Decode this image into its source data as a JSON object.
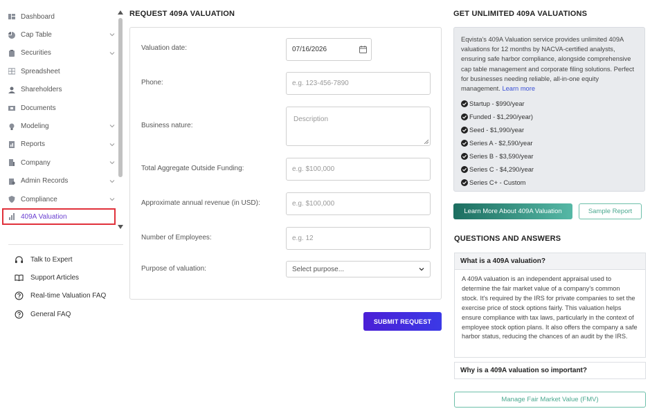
{
  "sidebar": {
    "items": [
      {
        "label": "Dashboard",
        "icon": "dashboard-icon",
        "chevron": false
      },
      {
        "label": "Cap Table",
        "icon": "pie-chart-icon",
        "chevron": true
      },
      {
        "label": "Securities",
        "icon": "clipboard-icon",
        "chevron": true
      },
      {
        "label": "Spreadsheet",
        "icon": "spreadsheet-icon",
        "chevron": false
      },
      {
        "label": "Shareholders",
        "icon": "user-icon",
        "chevron": false
      },
      {
        "label": "Documents",
        "icon": "folder-icon",
        "chevron": false
      },
      {
        "label": "Modeling",
        "icon": "lightbulb-icon",
        "chevron": true
      },
      {
        "label": "Reports",
        "icon": "report-icon",
        "chevron": true
      },
      {
        "label": "Company",
        "icon": "building-icon",
        "chevron": true
      },
      {
        "label": "Admin Records",
        "icon": "admin-icon",
        "chevron": true
      },
      {
        "label": "Compliance",
        "icon": "shield-icon",
        "chevron": true
      },
      {
        "label": "409A Valuation",
        "icon": "chart-icon",
        "chevron": false,
        "active": true
      }
    ],
    "help": [
      {
        "label": "Talk to Expert",
        "icon": "headset-icon"
      },
      {
        "label": "Support Articles",
        "icon": "book-icon"
      },
      {
        "label": "Real-time Valuation FAQ",
        "icon": "question-circle-icon"
      },
      {
        "label": "General FAQ",
        "icon": "question-circle-icon"
      }
    ]
  },
  "form": {
    "title": "REQUEST 409A VALUATION",
    "fields": {
      "valuation_date": {
        "label": "Valuation date:",
        "value": "07/16/2026"
      },
      "phone": {
        "label": "Phone:",
        "placeholder": "e.g. 123-456-7890"
      },
      "business_nature": {
        "label": "Business nature:",
        "placeholder": "Description"
      },
      "funding": {
        "label": "Total Aggregate Outside Funding:",
        "placeholder": "e.g. $100,000"
      },
      "revenue": {
        "label": "Approximate annual revenue (in USD):",
        "placeholder": "e.g. $100,000"
      },
      "employees": {
        "label": "Number of Employees:",
        "placeholder": "e.g. 12"
      },
      "purpose": {
        "label": "Purpose of valuation:",
        "selected": "Select purpose..."
      }
    },
    "submit_label": "SUBMIT REQUEST"
  },
  "promo": {
    "title": "GET UNLIMITED 409A VALUATIONS",
    "description": "Eqvista's 409A Valuation service provides unlimited 409A valuations for 12 months by NACVA-certified analysts, ensuring safe harbor compliance, alongside comprehensive cap table management and corporate filing solutions. Perfect for businesses needing reliable, all-in-one equity management.",
    "learn_more": "Learn more",
    "plans": [
      "Startup - $990/year",
      "Funded - $1,290/year)",
      "Seed - $1,990/year",
      "Series A - $2,590/year",
      "Series B - $3,590/year",
      "Series C - $4,290/year",
      "Series C+ - Custom"
    ],
    "learn_more_button": "Learn More About 409A Valuation",
    "sample_report_button": "Sample Report"
  },
  "faq": {
    "title": "QUESTIONS AND ANSWERS",
    "items": [
      {
        "question": "What is a 409A valuation?",
        "answer": "A 409A valuation is an independent appraisal used to determine the fair market value of a company's common stock. It's required by the IRS for private companies to set the exercise price of stock options fairly. This valuation helps ensure compliance with tax laws, particularly in the context of employee stock option plans. It also offers the company a safe harbor status, reducing the chances of an audit by the IRS."
      },
      {
        "question": "Why is a 409A valuation so important?"
      }
    ],
    "fmv_button": "Manage Fair Market Value (FMV)"
  },
  "colors": {
    "active": "#6a3fd1",
    "highlight": "#e0303a",
    "submit": "#4b1fd6",
    "teal": "#1c6e60"
  }
}
